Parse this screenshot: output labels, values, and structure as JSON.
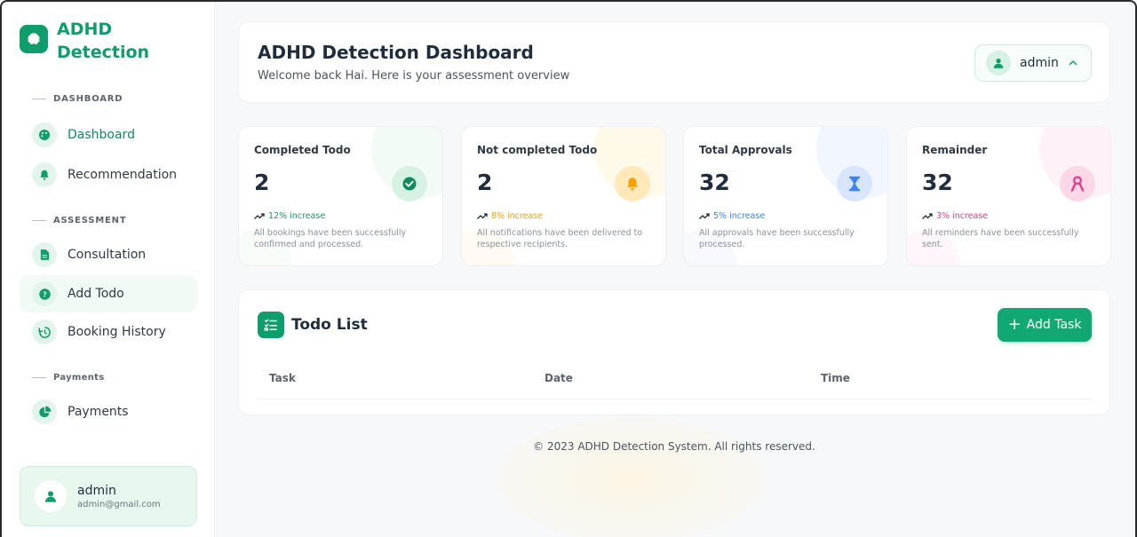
{
  "brand": {
    "line1": "ADHD",
    "line2": "Detection"
  },
  "sidebar": {
    "sections": [
      {
        "label": "DASHBOARD"
      },
      {
        "label": "ASSESSMENT"
      },
      {
        "label": "Payments"
      }
    ],
    "items": [
      {
        "label": "Dashboard",
        "icon": "palette-icon"
      },
      {
        "label": "Recommendation",
        "icon": "bell-icon"
      },
      {
        "label": "Consultation",
        "icon": "document-icon"
      },
      {
        "label": "Add Todo",
        "icon": "question-icon"
      },
      {
        "label": "Booking History",
        "icon": "history-icon"
      },
      {
        "label": "Payments",
        "icon": "pie-chart-icon"
      }
    ],
    "user": {
      "name": "admin",
      "email": "admin@gmail.com"
    }
  },
  "header": {
    "title": "ADHD Detection Dashboard",
    "subtitle": "Welcome back Hai. Here is your assessment overview",
    "user_menu_label": "admin"
  },
  "stats": [
    {
      "title": "Completed Todo",
      "value": "2",
      "trend": "12% increase",
      "description": "All bookings have been successfully confirmed and processed.",
      "color": "#0f9d6b",
      "icon": "check-circle-icon"
    },
    {
      "title": "Not completed Todo",
      "value": "2",
      "trend": "8% increase",
      "description": "All notifications have been delivered to respective recipients.",
      "color": "#f5a000",
      "icon": "bell-icon"
    },
    {
      "title": "Total Approvals",
      "value": "32",
      "trend": "5% increase",
      "description": "All approvals have been successfully processed.",
      "color": "#3b82f6",
      "icon": "hourglass-icon"
    },
    {
      "title": "Remainder",
      "value": "32",
      "trend": "3% increase",
      "description": "All reminders have been successfully sent.",
      "color": "#e23d8b",
      "icon": "ribbon-icon"
    }
  ],
  "todo": {
    "title": "Todo List",
    "add_button": "Add Task",
    "columns": [
      "Task",
      "Date",
      "Time"
    ]
  },
  "footer": "© 2023 ADHD Detection System. All rights reserved."
}
